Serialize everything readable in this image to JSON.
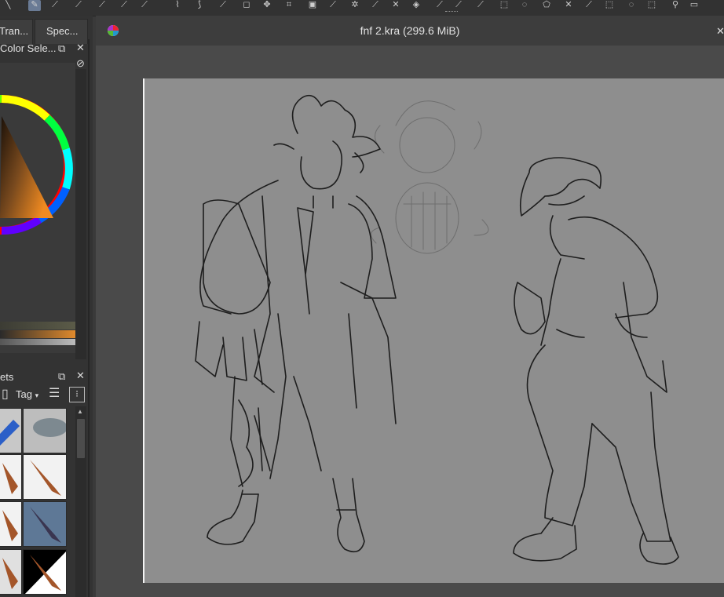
{
  "app": {
    "document_title": "fnf 2.kra (299.6 MiB)"
  },
  "left_dock": {
    "tabs": [
      "Tran...",
      "Spec..."
    ],
    "color_selector_title": "Color Sele...",
    "presets_title": "ets",
    "tag_label": "Tag"
  },
  "icons": {
    "krita_logo": "krita-logo-icon",
    "float": "float-panel-icon",
    "close": "close-icon",
    "block": "block-icon"
  },
  "colors": {
    "accent_selected": "#5e7896",
    "paper": "#8e8e8e",
    "canvas_bg": "#4a4a4a",
    "foreground_color": "#e08a2c"
  }
}
